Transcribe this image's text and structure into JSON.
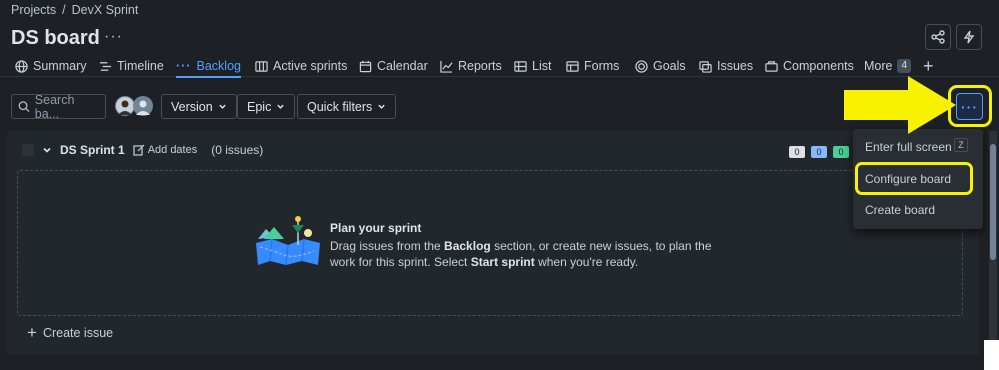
{
  "breadcrumb": {
    "root": "Projects",
    "sep": "/",
    "project": "DevX Sprint"
  },
  "page": {
    "title": "DS board",
    "more": "···"
  },
  "tabs": [
    {
      "label": "Summary",
      "icon": "globe-icon"
    },
    {
      "label": "Timeline",
      "icon": "timeline-icon"
    },
    {
      "label": "Backlog",
      "icon": "backlog-icon",
      "active": true
    },
    {
      "label": "Active sprints",
      "icon": "board-icon"
    },
    {
      "label": "Calendar",
      "icon": "calendar-icon"
    },
    {
      "label": "Reports",
      "icon": "chart-icon"
    },
    {
      "label": "List",
      "icon": "list-icon"
    },
    {
      "label": "Forms",
      "icon": "form-icon"
    },
    {
      "label": "Goals",
      "icon": "target-icon"
    },
    {
      "label": "Issues",
      "icon": "issues-icon"
    },
    {
      "label": "Components",
      "icon": "component-icon"
    },
    {
      "label": "More",
      "count": "4"
    }
  ],
  "toolbar": {
    "search_placeholder": "Search ba...",
    "version": "Version",
    "epic": "Epic",
    "quick_filters": "Quick filters",
    "more": "···"
  },
  "sprint": {
    "name": "DS Sprint 1",
    "add_dates": "Add dates",
    "issues": "(0 issues)",
    "counts": [
      "0",
      "0",
      "0"
    ]
  },
  "empty": {
    "title": "Plan your sprint",
    "desc_1": "Drag issues from the ",
    "desc_backlog": "Backlog",
    "desc_2": " section, or create new issues, to plan the work for this sprint. Select ",
    "desc_start": "Start sprint",
    "desc_3": " when you're ready."
  },
  "create_issue": "Create issue",
  "menu": {
    "fullscreen": "Enter full screen",
    "shortcut": "Z",
    "configure": "Configure board",
    "create": "Create board"
  },
  "colors": {
    "accent": "#579dff",
    "highlight": "#f8f200",
    "background": "#1d2125"
  }
}
